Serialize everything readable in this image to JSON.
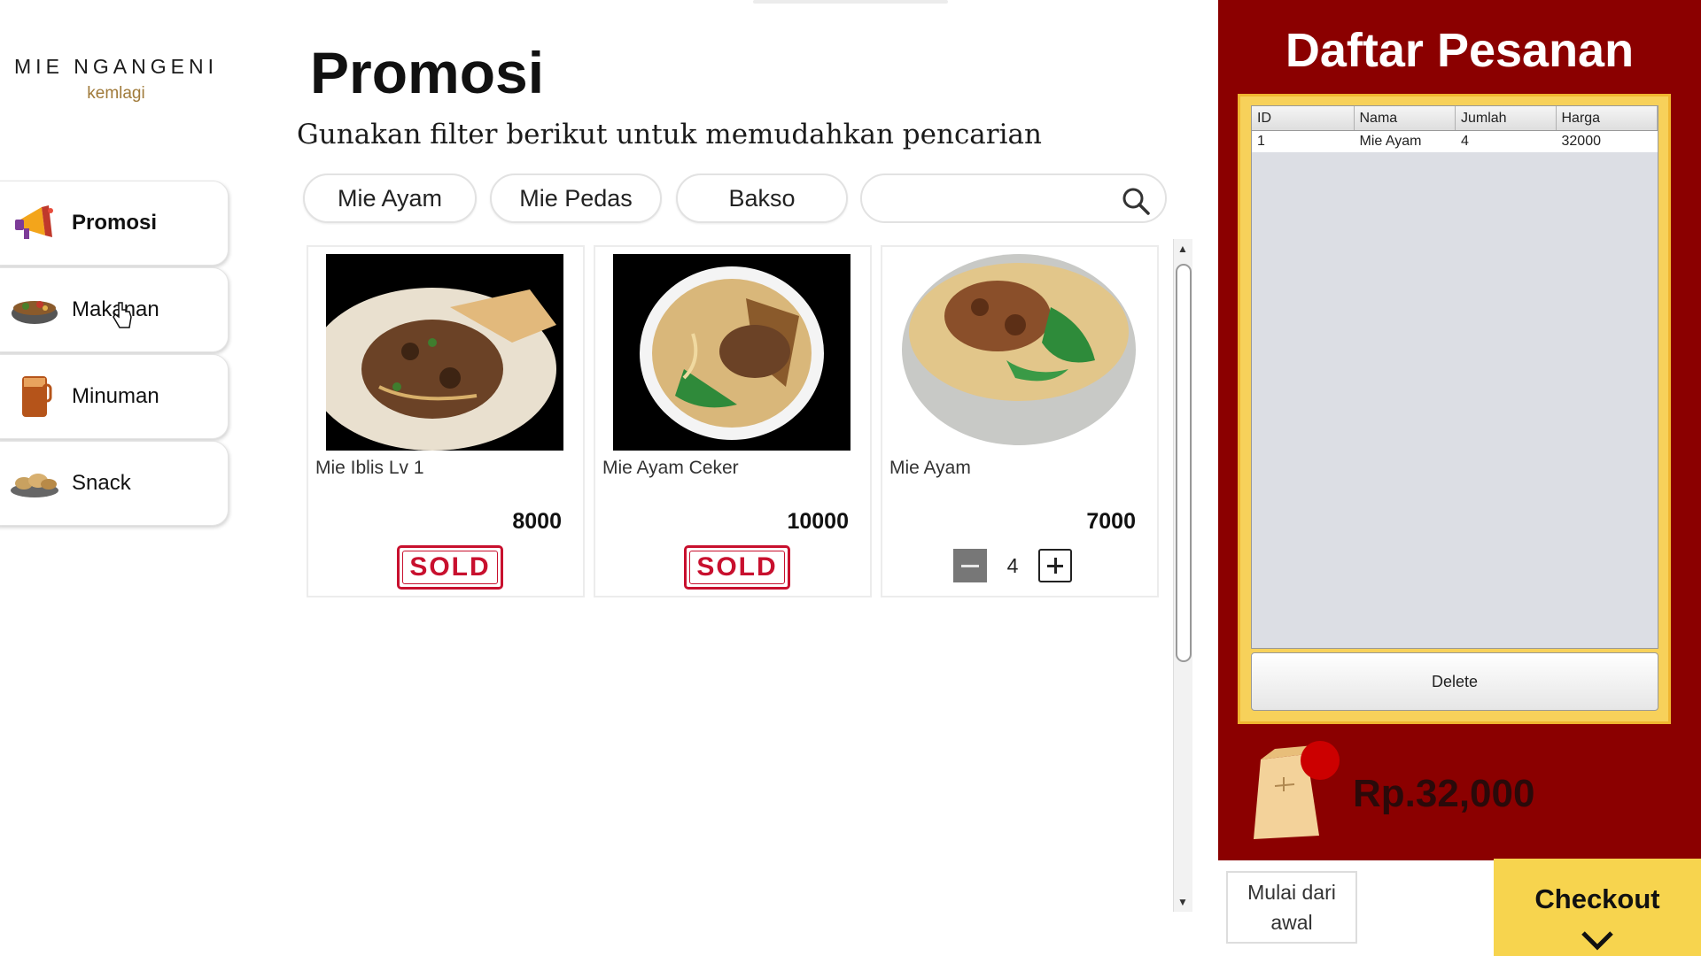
{
  "brand": {
    "name": "MIE NGANGENI",
    "sub": "kemlagi"
  },
  "sidebar": {
    "items": [
      {
        "label": "Promosi",
        "icon": "megaphone-icon",
        "active": true
      },
      {
        "label": "Makanan",
        "icon": "food-bowl-icon",
        "active": false
      },
      {
        "label": "Minuman",
        "icon": "iced-tea-icon",
        "active": false
      },
      {
        "label": "Snack",
        "icon": "snack-icon",
        "active": false
      }
    ]
  },
  "main": {
    "title": "Promosi",
    "subtitle": "Gunakan filter berikut untuk memudahkan pencarian",
    "filters": [
      "Mie Ayam",
      "Mie Pedas",
      "Bakso"
    ],
    "search": {
      "placeholder": "",
      "value": ""
    },
    "products": [
      {
        "name": "Mie Iblis Lv 1",
        "price": "8000",
        "status": "SOLD"
      },
      {
        "name": "Mie Ayam Ceker",
        "price": "10000",
        "status": "SOLD"
      },
      {
        "name": "Mie Ayam",
        "price": "7000",
        "quantity": "4"
      }
    ]
  },
  "order": {
    "title": "Daftar Pesanan",
    "columns": [
      "ID",
      "Nama",
      "Jumlah",
      "Harga"
    ],
    "rows": [
      [
        "1",
        "Mie Ayam",
        "4",
        "32000"
      ]
    ],
    "delete_label": "Delete",
    "total": "Rp.32,000"
  },
  "actions": {
    "reset_label": "Mulai dari awal",
    "checkout_label": "Checkout"
  },
  "colors": {
    "panel_bg": "#8b0000",
    "order_box": "#f7d15a",
    "checkout": "#f7d44e",
    "sold": "#c8102e"
  }
}
